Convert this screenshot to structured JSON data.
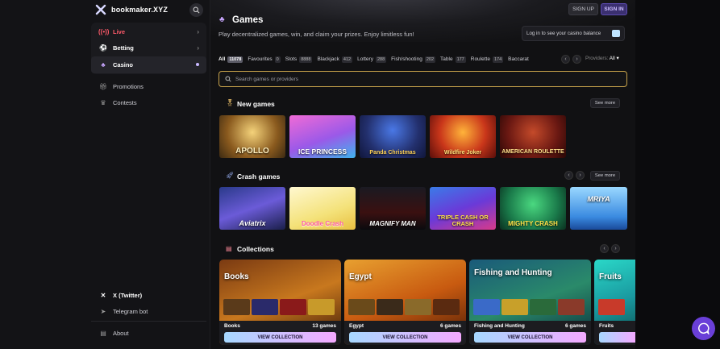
{
  "brand": {
    "name": "bookmaker.XYZ"
  },
  "sidebar": {
    "nav": [
      {
        "label": "Live",
        "icon": "live-icon"
      },
      {
        "label": "Betting",
        "icon": "soccer-ball-icon"
      },
      {
        "label": "Casino",
        "icon": "club-icon"
      }
    ],
    "links": [
      {
        "label": "Promotions",
        "icon": "gift-icon"
      },
      {
        "label": "Contests",
        "icon": "trophy-icon"
      }
    ],
    "footer": [
      {
        "label": "X (Twitter)",
        "icon": "x-icon"
      },
      {
        "label": "Telegram bot",
        "icon": "telegram-icon"
      },
      {
        "label": "About",
        "icon": "info-icon"
      }
    ]
  },
  "header": {
    "title": "Games",
    "subtitle": "Play decentralized games, win, and claim your prizes. Enjoy limitless fun!",
    "signup": "SIGN UP",
    "signin": "SIGN IN",
    "balance": "Log in to see your casino balance"
  },
  "tabs": [
    {
      "label": "All",
      "count": "11078"
    },
    {
      "label": "Favourites",
      "count": "0"
    },
    {
      "label": "Slots",
      "count": "8888"
    },
    {
      "label": "Blackjack",
      "count": "412"
    },
    {
      "label": "Lottery",
      "count": "288"
    },
    {
      "label": "Fish/shooting",
      "count": "202"
    },
    {
      "label": "Table",
      "count": "177"
    },
    {
      "label": "Roulette",
      "count": "174"
    },
    {
      "label": "Baccarat",
      "count": ""
    }
  ],
  "providers": {
    "label": "Providers:",
    "value": "All"
  },
  "search": {
    "placeholder": "Search games or providers"
  },
  "sections": {
    "new_games": {
      "title": "New games",
      "see_more": "See more",
      "games": [
        "APOLLO",
        "ICE PRINCESS",
        "Panda Christmas",
        "Wildfire Joker",
        "AMERICAN ROULETTE"
      ]
    },
    "crash_games": {
      "title": "Crash games",
      "see_more": "See more",
      "games": [
        "Aviatrix",
        "Doodle Crash",
        "MAGNIFY MAN",
        "TRIPLE CASH OR CRASH",
        "MIGHTY CRASH",
        "MRIYA"
      ]
    },
    "collections": {
      "title": "Collections",
      "items": [
        {
          "title": "Books",
          "name": "Books",
          "count": "13 games",
          "button": "VIEW COLLECTION"
        },
        {
          "title": "Egypt",
          "name": "Egypt",
          "count": "6 games",
          "button": "VIEW COLLECTION"
        },
        {
          "title": "Fishing and Hunting",
          "name": "Fishing and Hunting",
          "count": "6 games",
          "button": "VIEW COLLECTION"
        },
        {
          "title": "Fruits",
          "name": "Fruits",
          "count": "",
          "button": ""
        }
      ]
    }
  },
  "colors": {
    "accent": "#6a3fd8",
    "live": "#ff5a6a",
    "search_border": "#c5a04a"
  }
}
